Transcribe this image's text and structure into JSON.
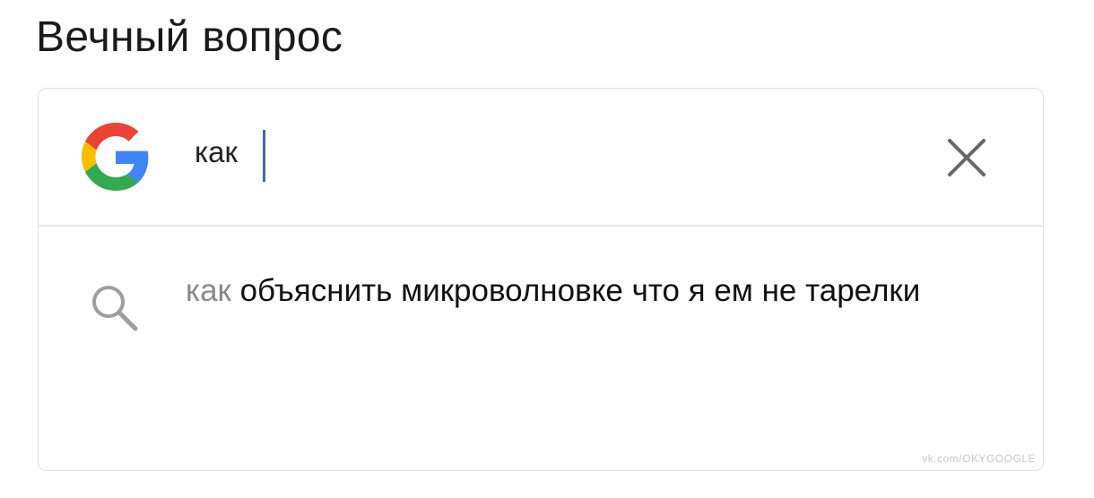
{
  "post": {
    "title": "Вечный вопрос"
  },
  "search": {
    "logo_icon": "google-g-icon",
    "query": "как",
    "clear_icon": "close-icon"
  },
  "suggestion": {
    "icon": "search-icon",
    "prefix": "как",
    "rest": " объяснить микроволновке что я ем не тарелки"
  },
  "watermark": "vk.com/OKYGOOGLE",
  "colors": {
    "google_blue": "#4285F4",
    "google_red": "#EA4335",
    "google_yellow": "#FBBC05",
    "google_green": "#34A853",
    "cursor": "#4a6a9a",
    "suggestion_prefix": "#8a8a8a",
    "icon_gray": "#9e9e9e"
  }
}
